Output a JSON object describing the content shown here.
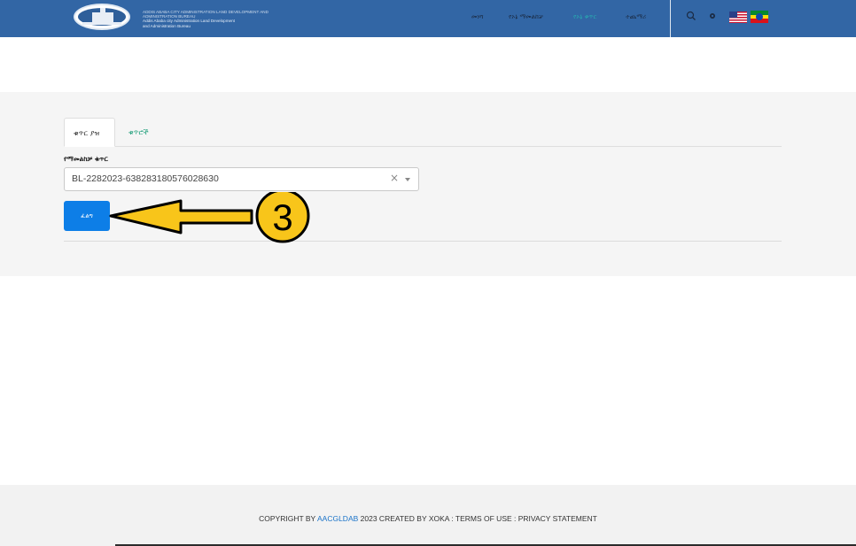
{
  "header": {
    "logo_text": "ADDIS ABABA CITY ADMINISTRATION LAND DEVELOPMENT AND ADMINISTRATION BUREAU",
    "logo_line1": "Addis Ababa city Administration Land Development",
    "logo_line2": "and Administration Bureau",
    "nav": [
      {
        "label": "መነሻ",
        "active": false
      },
      {
        "label": "የኦኔ ማመልከቻ",
        "active": false
      },
      {
        "label": "የኦኔ ቁጥር",
        "active": true
      },
      {
        "label": "ተጨማሪ",
        "active": false
      }
    ],
    "icons": [
      "search-icon",
      "gear-icon"
    ],
    "flags": [
      "us-flag-icon",
      "ethiopia-flag-icon"
    ]
  },
  "main": {
    "tabs": [
      {
        "label": "ቁጥር ያዝ",
        "active": true
      },
      {
        "label": "ቁጥሮች",
        "active": false
      }
    ],
    "field_label": "የማመልከቻ ቁጥር",
    "select_value": "BL-2282023-638283180576028630",
    "search_button": "ፈልግ",
    "annotation_number": "3"
  },
  "footer": {
    "prefix": "COPYRIGHT BY",
    "link": "AACGLDAB",
    "suffix": "2023 CREATED BY XOKA : TERMS OF USE : PRIVACY STATEMENT"
  },
  "colors": {
    "header_bg": "#3266a5",
    "active_nav": "#28a9b0",
    "primary_button": "#0d7ee7",
    "annotation_fill": "#f8c51a"
  }
}
